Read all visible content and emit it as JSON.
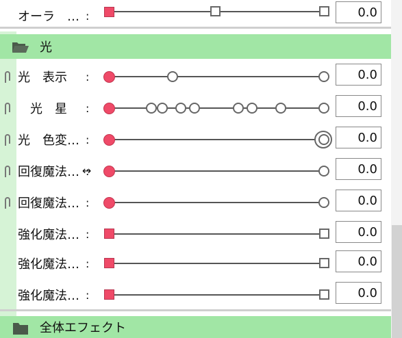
{
  "rows": [
    {
      "label": "オーラ　…",
      "colon": ":",
      "value": "0.0"
    },
    {
      "label": "光　表示",
      "colon": ":",
      "value": "0.0"
    },
    {
      "label": "　光　星",
      "colon": ":",
      "value": "0.0"
    },
    {
      "label": "光　色変…",
      "colon": ":",
      "value": "0.0"
    },
    {
      "label": "回復魔法…",
      "colon": ":",
      "value": "0.0"
    },
    {
      "label": "回復魔法…",
      "colon": ":",
      "value": "0.0"
    },
    {
      "label": "強化魔法…",
      "colon": ":",
      "value": "0.0"
    },
    {
      "label": "強化魔法…",
      "colon": ":",
      "value": "0.0"
    },
    {
      "label": "強化魔法…",
      "colon": ":",
      "value": "0.0"
    }
  ],
  "groups": {
    "light": {
      "title": "光",
      "icon": "folder-open-icon"
    },
    "whole": {
      "title": "全体エフェクト",
      "icon": "folder-icon"
    }
  },
  "cursor": {
    "glyph": "↔"
  },
  "colors": {
    "accent_key": "#ef4a68",
    "group_header": "#a1e6a5",
    "gutter": "#d6f3d6"
  }
}
